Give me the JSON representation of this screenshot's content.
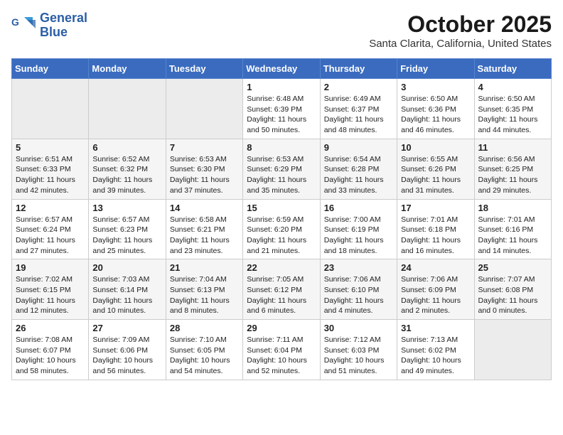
{
  "header": {
    "logo_line1": "General",
    "logo_line2": "Blue",
    "main_title": "October 2025",
    "subtitle": "Santa Clarita, California, United States"
  },
  "weekdays": [
    "Sunday",
    "Monday",
    "Tuesday",
    "Wednesday",
    "Thursday",
    "Friday",
    "Saturday"
  ],
  "weeks": [
    [
      {
        "day": "",
        "empty": true
      },
      {
        "day": "",
        "empty": true
      },
      {
        "day": "",
        "empty": true
      },
      {
        "day": "1",
        "sunrise": "6:48 AM",
        "sunset": "6:39 PM",
        "daylight": "11 hours and 50 minutes."
      },
      {
        "day": "2",
        "sunrise": "6:49 AM",
        "sunset": "6:37 PM",
        "daylight": "11 hours and 48 minutes."
      },
      {
        "day": "3",
        "sunrise": "6:50 AM",
        "sunset": "6:36 PM",
        "daylight": "11 hours and 46 minutes."
      },
      {
        "day": "4",
        "sunrise": "6:50 AM",
        "sunset": "6:35 PM",
        "daylight": "11 hours and 44 minutes."
      }
    ],
    [
      {
        "day": "5",
        "sunrise": "6:51 AM",
        "sunset": "6:33 PM",
        "daylight": "11 hours and 42 minutes."
      },
      {
        "day": "6",
        "sunrise": "6:52 AM",
        "sunset": "6:32 PM",
        "daylight": "11 hours and 39 minutes."
      },
      {
        "day": "7",
        "sunrise": "6:53 AM",
        "sunset": "6:30 PM",
        "daylight": "11 hours and 37 minutes."
      },
      {
        "day": "8",
        "sunrise": "6:53 AM",
        "sunset": "6:29 PM",
        "daylight": "11 hours and 35 minutes."
      },
      {
        "day": "9",
        "sunrise": "6:54 AM",
        "sunset": "6:28 PM",
        "daylight": "11 hours and 33 minutes."
      },
      {
        "day": "10",
        "sunrise": "6:55 AM",
        "sunset": "6:26 PM",
        "daylight": "11 hours and 31 minutes."
      },
      {
        "day": "11",
        "sunrise": "6:56 AM",
        "sunset": "6:25 PM",
        "daylight": "11 hours and 29 minutes."
      }
    ],
    [
      {
        "day": "12",
        "sunrise": "6:57 AM",
        "sunset": "6:24 PM",
        "daylight": "11 hours and 27 minutes."
      },
      {
        "day": "13",
        "sunrise": "6:57 AM",
        "sunset": "6:23 PM",
        "daylight": "11 hours and 25 minutes."
      },
      {
        "day": "14",
        "sunrise": "6:58 AM",
        "sunset": "6:21 PM",
        "daylight": "11 hours and 23 minutes."
      },
      {
        "day": "15",
        "sunrise": "6:59 AM",
        "sunset": "6:20 PM",
        "daylight": "11 hours and 21 minutes."
      },
      {
        "day": "16",
        "sunrise": "7:00 AM",
        "sunset": "6:19 PM",
        "daylight": "11 hours and 18 minutes."
      },
      {
        "day": "17",
        "sunrise": "7:01 AM",
        "sunset": "6:18 PM",
        "daylight": "11 hours and 16 minutes."
      },
      {
        "day": "18",
        "sunrise": "7:01 AM",
        "sunset": "6:16 PM",
        "daylight": "11 hours and 14 minutes."
      }
    ],
    [
      {
        "day": "19",
        "sunrise": "7:02 AM",
        "sunset": "6:15 PM",
        "daylight": "11 hours and 12 minutes."
      },
      {
        "day": "20",
        "sunrise": "7:03 AM",
        "sunset": "6:14 PM",
        "daylight": "11 hours and 10 minutes."
      },
      {
        "day": "21",
        "sunrise": "7:04 AM",
        "sunset": "6:13 PM",
        "daylight": "11 hours and 8 minutes."
      },
      {
        "day": "22",
        "sunrise": "7:05 AM",
        "sunset": "6:12 PM",
        "daylight": "11 hours and 6 minutes."
      },
      {
        "day": "23",
        "sunrise": "7:06 AM",
        "sunset": "6:10 PM",
        "daylight": "11 hours and 4 minutes."
      },
      {
        "day": "24",
        "sunrise": "7:06 AM",
        "sunset": "6:09 PM",
        "daylight": "11 hours and 2 minutes."
      },
      {
        "day": "25",
        "sunrise": "7:07 AM",
        "sunset": "6:08 PM",
        "daylight": "11 hours and 0 minutes."
      }
    ],
    [
      {
        "day": "26",
        "sunrise": "7:08 AM",
        "sunset": "6:07 PM",
        "daylight": "10 hours and 58 minutes."
      },
      {
        "day": "27",
        "sunrise": "7:09 AM",
        "sunset": "6:06 PM",
        "daylight": "10 hours and 56 minutes."
      },
      {
        "day": "28",
        "sunrise": "7:10 AM",
        "sunset": "6:05 PM",
        "daylight": "10 hours and 54 minutes."
      },
      {
        "day": "29",
        "sunrise": "7:11 AM",
        "sunset": "6:04 PM",
        "daylight": "10 hours and 52 minutes."
      },
      {
        "day": "30",
        "sunrise": "7:12 AM",
        "sunset": "6:03 PM",
        "daylight": "10 hours and 51 minutes."
      },
      {
        "day": "31",
        "sunrise": "7:13 AM",
        "sunset": "6:02 PM",
        "daylight": "10 hours and 49 minutes."
      },
      {
        "day": "",
        "empty": true
      }
    ]
  ],
  "labels": {
    "sunrise_prefix": "Sunrise: ",
    "sunset_prefix": "Sunset: ",
    "daylight_prefix": "Daylight: "
  }
}
